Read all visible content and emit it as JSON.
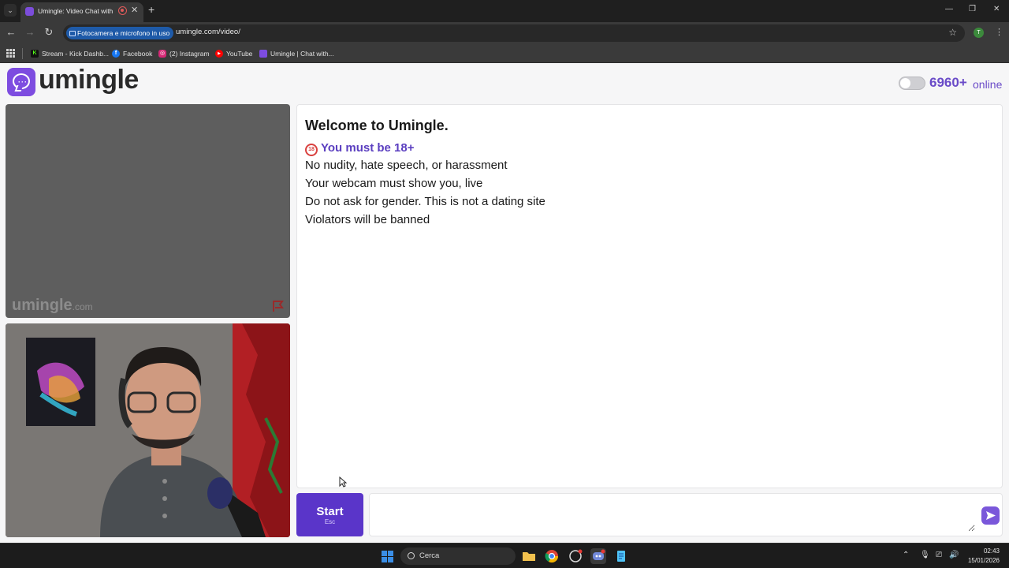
{
  "browser": {
    "tab_title": "Umingle: Video Chat with S",
    "tab_close": "✕",
    "new_tab": "+",
    "camera_pill": "Fotocamera e microfono in uso",
    "url": "umingle.com/video/",
    "profile_initial": "T",
    "bookmarks": [
      {
        "label": "Stream - Kick Dashb...",
        "icon": "kick-icon",
        "color": "#53fc18"
      },
      {
        "label": "Facebook",
        "icon": "facebook-icon",
        "color": "#1877f2"
      },
      {
        "label": "(2) Instagram",
        "icon": "instagram-icon",
        "color": "#d62976"
      },
      {
        "label": "YouTube",
        "icon": "youtube-icon",
        "color": "#ff0000"
      },
      {
        "label": "Umingle | Chat with...",
        "icon": "umingle-icon",
        "color": "#7d4ce0"
      }
    ]
  },
  "header": {
    "logo_text": "umingle",
    "online_count": "6960+",
    "online_label": "online"
  },
  "video": {
    "watermark": "umingle",
    "watermark_suffix": ".com"
  },
  "chat": {
    "welcome": "Welcome to Umingle.",
    "age_badge": "18",
    "age_rule": "You must be 18+",
    "rules": [
      "No nudity, hate speech, or harassment",
      "Your webcam must show you, live",
      "Do not ask for gender. This is not a dating site",
      "Violators will be banned"
    ],
    "message_placeholder": ""
  },
  "controls": {
    "start_label": "Start",
    "start_hint": "Esc"
  },
  "taskbar": {
    "search_label": "Cerca",
    "time": "02:43",
    "date": "15/01/2026"
  },
  "colors": {
    "brand": "#7d4ce0",
    "start_button": "#5a35c9",
    "online_text": "#6a4bc8"
  }
}
